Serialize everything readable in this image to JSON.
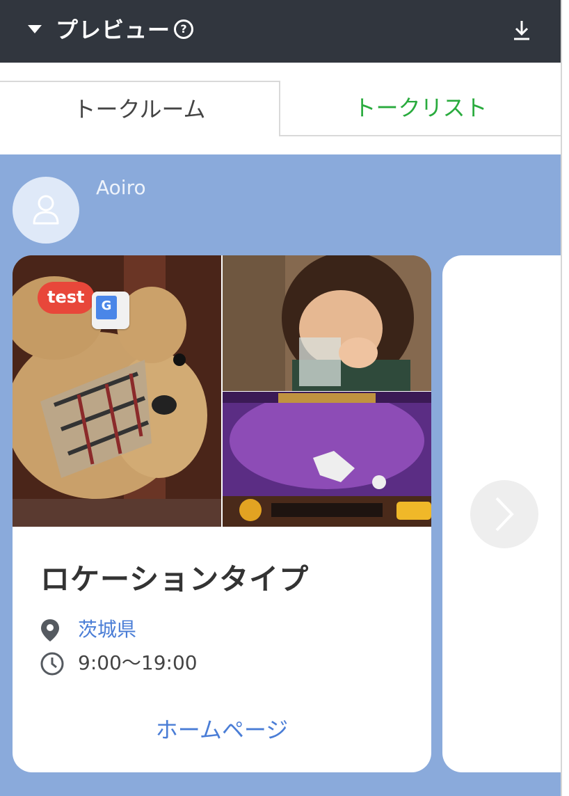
{
  "header": {
    "title": "プレビュー",
    "help_glyph": "?"
  },
  "tabs": [
    {
      "label": "トークルーム",
      "active": true
    },
    {
      "label": "トークリスト",
      "active": false
    }
  ],
  "chat": {
    "sender_name": "Aoiro",
    "card": {
      "badge": "test",
      "title": "ロケーションタイプ",
      "location": "茨城県",
      "hours": "9:00〜19:00",
      "link": "ホームページ"
    }
  },
  "colors": {
    "header_bg": "#31363e",
    "chat_bg": "#8aaadb",
    "active_tab_text": "#444444",
    "inactive_tab_text": "#2aab3e",
    "link": "#4a7dd6",
    "badge": "#e8473a"
  },
  "icons": {
    "collapse": "caret-down-icon",
    "help": "question-circle-icon",
    "download": "download-icon",
    "avatar": "user-icon",
    "translate": "translate-icon",
    "location": "map-pin-icon",
    "hours": "clock-icon",
    "next": "chevron-right-icon"
  }
}
